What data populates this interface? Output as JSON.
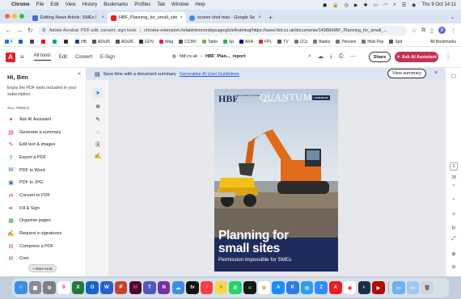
{
  "menubar": {
    "app": "Chrome",
    "items": [
      "File",
      "Edit",
      "View",
      "History",
      "Bookmarks",
      "Profiles",
      "Tab",
      "Window",
      "Help"
    ],
    "clock": "Thu 9 Oct  14:11"
  },
  "tabs": [
    {
      "title": "Editing News Article: SMEs I",
      "color": "#3c6fcf"
    },
    {
      "title": "HBF_Planning_for_small_site",
      "color": "#e61e26"
    },
    {
      "title": "screen shot mac - Google Se",
      "color": "#4285f4"
    }
  ],
  "address": {
    "chip": "Adobe Acrobat: PDF edit, convert, sign tools",
    "url": "chrome-extension://efaidnbmnnnibpcajpcglclefindmkaj/https://www.hbf.co.uk/documents/14988/HBF_Planning_for_small_..."
  },
  "bookmarks": {
    "items": [
      {
        "label": "F",
        "color": "#1877f2"
      },
      {
        "label": "",
        "color": "#0a66c2"
      },
      {
        "label": "",
        "color": "#444"
      },
      {
        "label": "",
        "color": "#ff0000"
      },
      {
        "label": "",
        "color": "#00a884"
      },
      {
        "label": "",
        "color": "#333"
      },
      {
        "label": "HB",
        "color": "#1c3f8f"
      },
      {
        "label": "ADs25",
        "color": "#555"
      },
      {
        "label": "ADs26",
        "color": "#555"
      },
      {
        "label": "GOV",
        "color": "#333"
      },
      {
        "label": "Wag",
        "color": "#e0245e"
      },
      {
        "label": "CCMV",
        "color": "#555"
      },
      {
        "label": "Table",
        "color": "#8a5"
      },
      {
        "label": "Sp",
        "color": "#1db954"
      },
      {
        "label": "AXA",
        "color": "#00008f"
      },
      {
        "label": "FPL",
        "color": "#c33"
      },
      {
        "label": "TV",
        "color": "#555"
      },
      {
        "label": "CCs",
        "color": "#777"
      },
      {
        "label": "Banks",
        "color": "#777"
      },
      {
        "label": "Pension",
        "color": "#777"
      },
      {
        "label": "Hols Pay",
        "color": "#777"
      },
      {
        "label": "Spd",
        "color": "#555"
      }
    ],
    "all_label": "All Bookmarks"
  },
  "acrobat": {
    "menus": [
      "All tools",
      "Edit",
      "Convert",
      "E-Sign"
    ],
    "site": "hbf.co.uk",
    "doc": "HBF_Plan..._report",
    "share": "Share",
    "ai": "Ask AI Assistant"
  },
  "panel": {
    "greeting": "Hi, Ben",
    "intro": "Enjoy the PDF tools included in your subscription.",
    "section": "ALL TOOLS",
    "tools": [
      {
        "label": "Ask AI Assistant",
        "icon": "✦",
        "color": "#c82e56"
      },
      {
        "label": "Generate a summary",
        "icon": "▤",
        "color": "#c82e56"
      },
      {
        "label": "Edit text & images",
        "icon": "✎",
        "color": "#c82e56"
      },
      {
        "label": "Export a PDF",
        "icon": "⇪",
        "color": "#3b63c9"
      },
      {
        "label": "PDF to Word",
        "icon": "W",
        "color": "#2b5fcf"
      },
      {
        "label": "PDF to JPG",
        "icon": "▣",
        "color": "#3b63c9"
      },
      {
        "label": "Convert to PDF",
        "icon": "⇄",
        "color": "#c82e56"
      },
      {
        "label": "Fill & Sign",
        "icon": "✒",
        "color": "#7a3cc9"
      },
      {
        "label": "Organise pages",
        "icon": "▦",
        "color": "#2e9e5c"
      },
      {
        "label": "Request e-signatures",
        "icon": "✍",
        "color": "#7a3cc9"
      },
      {
        "label": "Compress a PDF",
        "icon": "⊟",
        "color": "#c82e56"
      },
      {
        "label": "Com",
        "icon": "✉",
        "color": "#3b63c9"
      }
    ],
    "more_tools": "+ More tools"
  },
  "banner": {
    "text": "Save time with a document summary",
    "link": "Generative AI User Guidelines",
    "button": "View summary"
  },
  "document": {
    "brand1": "HBF",
    "brand1_sub": "Home Builders Federation",
    "brand2": "QUANTUM",
    "brand2_sub": "DEVELOPMENT FINANCE",
    "brand3": "LICHFIELDS",
    "title_line1": "Planning for",
    "title_line2": "small sites",
    "subtitle": "Permission impossible for SMEs"
  },
  "rail": {
    "page_current": "1",
    "page_total": "28"
  },
  "dock": [
    {
      "name": "finder",
      "color": "#3b8ee8",
      "glyph": "☺"
    },
    {
      "name": "launchpad",
      "color": "#8a8a9a",
      "glyph": "▦"
    },
    {
      "name": "system-settings",
      "color": "#7d7d85",
      "glyph": "⚙"
    },
    {
      "name": "calendar",
      "color": "#ffffff",
      "glyph": "9",
      "fg": "#e33"
    },
    {
      "name": "excel",
      "color": "#1f7a43",
      "glyph": "X"
    },
    {
      "name": "outlook",
      "color": "#1066c8",
      "glyph": "O"
    },
    {
      "name": "word",
      "color": "#2b5fcf",
      "glyph": "W"
    },
    {
      "name": "powerpoint",
      "color": "#c4442a",
      "glyph": "P"
    },
    {
      "name": "indesign",
      "color": "#4b0b2e",
      "glyph": "Id",
      "fg": "#ff3c8a"
    },
    {
      "name": "teams",
      "color": "#5158bb",
      "glyph": "T"
    },
    {
      "name": "onenote",
      "color": "#7a2fa5",
      "glyph": "N"
    },
    {
      "name": "icloud",
      "color": "#3b8ee8",
      "glyph": "☁"
    },
    {
      "name": "apple-tv",
      "color": "#111",
      "glyph": "tv"
    },
    {
      "name": "music",
      "color": "#fc3c44",
      "glyph": "♫"
    },
    {
      "name": "notes",
      "color": "#f6d94b",
      "glyph": "≡",
      "fg": "#555"
    },
    {
      "name": "whatsapp",
      "color": "#25d366",
      "glyph": "✆"
    },
    {
      "name": "spotify",
      "color": "#191414",
      "glyph": "≋",
      "fg": "#1db954"
    },
    {
      "name": "photos",
      "color": "#ffffff",
      "glyph": "✿",
      "fg": "#e84"
    },
    {
      "name": "app-store",
      "color": "#1a8cff",
      "glyph": "A"
    },
    {
      "name": "keynote",
      "color": "#2f7ce8",
      "glyph": "K"
    },
    {
      "name": "safari",
      "color": "#2a9df4",
      "glyph": "◎"
    },
    {
      "name": "zoom",
      "color": "#2d8cff",
      "glyph": "Z"
    },
    {
      "name": "acrobat",
      "color": "#e61e26",
      "glyph": "A"
    },
    {
      "name": "chrome",
      "color": "#ffffff",
      "glyph": "◉",
      "fg": "#db4437"
    },
    {
      "name": "capture",
      "color": "#1c2b4a",
      "glyph": "◐"
    },
    {
      "name": "adobe-reader",
      "color": "#b30b00",
      "glyph": "▶"
    },
    {
      "name": "folder",
      "color": "#6fb0f0",
      "glyph": "▭"
    },
    {
      "name": "downloads",
      "color": "#9ecaf2",
      "glyph": "▭"
    },
    {
      "name": "trash",
      "color": "#d0d4da",
      "glyph": "🗑",
      "fg": "#666"
    }
  ]
}
